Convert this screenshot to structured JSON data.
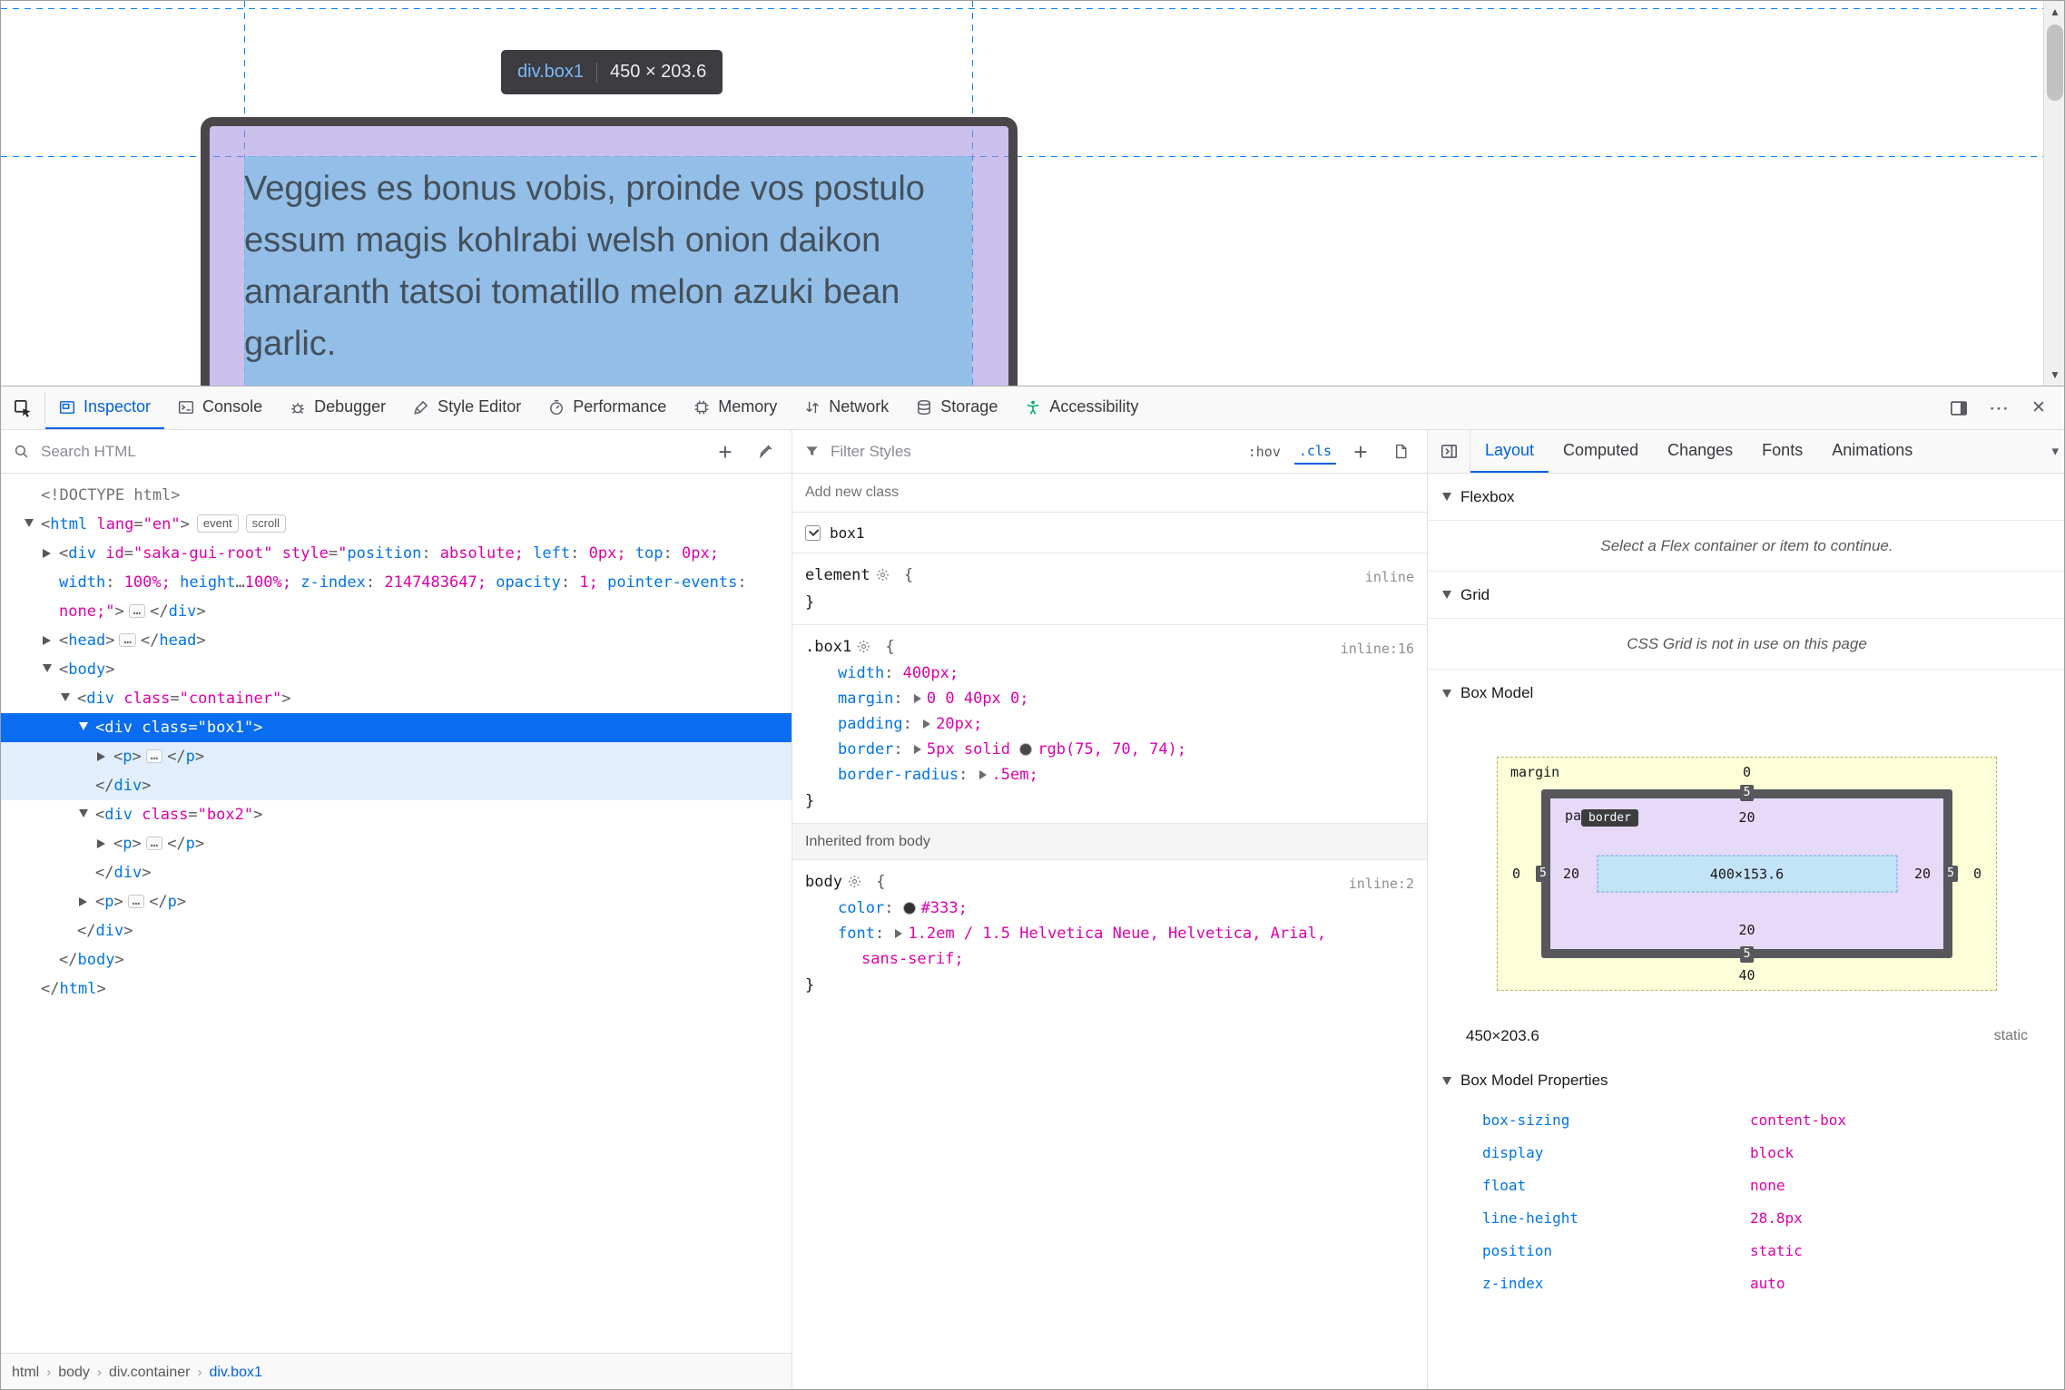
{
  "viewport": {
    "tooltip": {
      "selector": "div.box1",
      "dims": "450 × 203.6"
    },
    "content_lines": "Veggies es bonus vobis, proinde vos postulo\nessum magis kohlrabi welsh onion daikon\namaranth tatsoi tomatillo melon azuki bean\ngarlic."
  },
  "toolbar": {
    "tabs": [
      {
        "label": "Inspector",
        "icon": "inspector-icon",
        "active": true
      },
      {
        "label": "Console",
        "icon": "console-icon"
      },
      {
        "label": "Debugger",
        "icon": "debugger-icon"
      },
      {
        "label": "Style Editor",
        "icon": "style-editor-icon"
      },
      {
        "label": "Performance",
        "icon": "performance-icon"
      },
      {
        "label": "Memory",
        "icon": "memory-icon"
      },
      {
        "label": "Network",
        "icon": "network-icon"
      },
      {
        "label": "Storage",
        "icon": "storage-icon"
      },
      {
        "label": "Accessibility",
        "icon": "accessibility-icon"
      }
    ]
  },
  "markup": {
    "search_placeholder": "Search HTML",
    "breadcrumbs": [
      {
        "label": "html"
      },
      {
        "label": "body"
      },
      {
        "label": "div.container"
      },
      {
        "label": "div.box1",
        "selected": true
      }
    ],
    "tree": [
      {
        "i": 0,
        "p": [
          {
            "t": "<!DOCTYPE html>",
            "c": "d"
          }
        ]
      },
      {
        "i": 0,
        "tw": "o",
        "p": [
          {
            "t": "<",
            "c": "p"
          },
          {
            "t": "html",
            "c": "t"
          },
          {
            "t": " ",
            "c": "p"
          },
          {
            "t": "lang",
            "c": "a"
          },
          {
            "t": "=",
            "c": "p"
          },
          {
            "t": "\"en\"",
            "c": "a"
          },
          {
            "t": ">",
            "c": "p"
          },
          {
            "b": "event"
          },
          {
            "b": "scroll"
          }
        ]
      },
      {
        "i": 1,
        "tw": "c",
        "p": [
          {
            "t": "<",
            "c": "p"
          },
          {
            "t": "div",
            "c": "t"
          },
          {
            "t": " ",
            "c": "p"
          },
          {
            "t": "id",
            "c": "a"
          },
          {
            "t": "=",
            "c": "p"
          },
          {
            "t": "\"saka-gui-root\"",
            "c": "a"
          },
          {
            "t": " ",
            "c": "p"
          },
          {
            "t": "style",
            "c": "a"
          },
          {
            "t": "=",
            "c": "p"
          },
          {
            "t": "\"",
            "c": "a"
          },
          {
            "t": "position",
            "c": "n"
          },
          {
            "t": ": ",
            "c": "p"
          },
          {
            "t": "absolute;",
            "c": "v"
          },
          {
            "t": " ",
            "c": "p"
          },
          {
            "t": "left",
            "c": "n"
          },
          {
            "t": ": ",
            "c": "p"
          },
          {
            "t": "0px;",
            "c": "v"
          },
          {
            "t": " ",
            "c": "p"
          },
          {
            "t": "top",
            "c": "n"
          },
          {
            "t": ": ",
            "c": "p"
          },
          {
            "t": "0px;",
            "c": "v"
          },
          {
            "t": " ",
            "c": "p"
          },
          {
            "t": "width",
            "c": "n"
          },
          {
            "t": ": ",
            "c": "p"
          },
          {
            "t": "100%;",
            "c": "v"
          },
          {
            "t": " ",
            "c": "p"
          },
          {
            "t": "height",
            "c": "n"
          },
          {
            "t": "…",
            "c": "p"
          },
          {
            "t": "100%;",
            "c": "v"
          },
          {
            "t": " ",
            "c": "p"
          },
          {
            "t": "z-index",
            "c": "n"
          },
          {
            "t": ": ",
            "c": "p"
          },
          {
            "t": "2147483647;",
            "c": "v"
          },
          {
            "t": " ",
            "c": "p"
          },
          {
            "t": "opacity",
            "c": "n"
          },
          {
            "t": ": ",
            "c": "p"
          },
          {
            "t": "1;",
            "c": "v"
          },
          {
            "t": " ",
            "c": "p"
          },
          {
            "t": "pointer-events",
            "c": "n"
          },
          {
            "t": ": ",
            "c": "p"
          },
          {
            "t": "none;",
            "c": "v"
          },
          {
            "t": "\"",
            "c": "a"
          },
          {
            "t": ">",
            "c": "p"
          },
          {
            "e": true
          },
          {
            "t": "</",
            "c": "p"
          },
          {
            "t": "div",
            "c": "t"
          },
          {
            "t": ">",
            "c": "p"
          }
        ]
      },
      {
        "i": 1,
        "tw": "c",
        "p": [
          {
            "t": "<",
            "c": "p"
          },
          {
            "t": "head",
            "c": "t"
          },
          {
            "t": ">",
            "c": "p"
          },
          {
            "e": true
          },
          {
            "t": "</",
            "c": "p"
          },
          {
            "t": "head",
            "c": "t"
          },
          {
            "t": ">",
            "c": "p"
          }
        ]
      },
      {
        "i": 1,
        "tw": "o",
        "p": [
          {
            "t": "<",
            "c": "p"
          },
          {
            "t": "body",
            "c": "t"
          },
          {
            "t": ">",
            "c": "p"
          }
        ]
      },
      {
        "i": 2,
        "tw": "o",
        "p": [
          {
            "t": "<",
            "c": "p"
          },
          {
            "t": "div",
            "c": "t"
          },
          {
            "t": " ",
            "c": "p"
          },
          {
            "t": "class",
            "c": "a"
          },
          {
            "t": "=",
            "c": "p"
          },
          {
            "t": "\"container\"",
            "c": "a"
          },
          {
            "t": ">",
            "c": "p"
          }
        ]
      },
      {
        "i": 3,
        "tw": "o",
        "sel": true,
        "p": [
          {
            "t": "<",
            "c": "p"
          },
          {
            "t": "div",
            "c": "t"
          },
          {
            "t": " ",
            "c": "p"
          },
          {
            "t": "class",
            "c": "a"
          },
          {
            "t": "=",
            "c": "p"
          },
          {
            "t": "\"box1\"",
            "c": "a"
          },
          {
            "t": ">",
            "c": "p"
          }
        ]
      },
      {
        "i": 4,
        "tw": "c",
        "hl": true,
        "p": [
          {
            "t": "<",
            "c": "p"
          },
          {
            "t": "p",
            "c": "t"
          },
          {
            "t": ">",
            "c": "p"
          },
          {
            "e": true
          },
          {
            "t": "</",
            "c": "p"
          },
          {
            "t": "p",
            "c": "t"
          },
          {
            "t": ">",
            "c": "p"
          }
        ]
      },
      {
        "i": 3,
        "hl": true,
        "p": [
          {
            "t": "</",
            "c": "p"
          },
          {
            "t": "div",
            "c": "t"
          },
          {
            "t": ">",
            "c": "p"
          }
        ]
      },
      {
        "i": 3,
        "tw": "o",
        "p": [
          {
            "t": "<",
            "c": "p"
          },
          {
            "t": "div",
            "c": "t"
          },
          {
            "t": " ",
            "c": "p"
          },
          {
            "t": "class",
            "c": "a"
          },
          {
            "t": "=",
            "c": "p"
          },
          {
            "t": "\"box2\"",
            "c": "a"
          },
          {
            "t": ">",
            "c": "p"
          }
        ]
      },
      {
        "i": 4,
        "tw": "c",
        "p": [
          {
            "t": "<",
            "c": "p"
          },
          {
            "t": "p",
            "c": "t"
          },
          {
            "t": ">",
            "c": "p"
          },
          {
            "e": true
          },
          {
            "t": "</",
            "c": "p"
          },
          {
            "t": "p",
            "c": "t"
          },
          {
            "t": ">",
            "c": "p"
          }
        ]
      },
      {
        "i": 3,
        "p": [
          {
            "t": "</",
            "c": "p"
          },
          {
            "t": "div",
            "c": "t"
          },
          {
            "t": ">",
            "c": "p"
          }
        ]
      },
      {
        "i": 3,
        "tw": "c",
        "p": [
          {
            "t": "<",
            "c": "p"
          },
          {
            "t": "p",
            "c": "t"
          },
          {
            "t": ">",
            "c": "p"
          },
          {
            "e": true
          },
          {
            "t": "</",
            "c": "p"
          },
          {
            "t": "p",
            "c": "t"
          },
          {
            "t": ">",
            "c": "p"
          }
        ]
      },
      {
        "i": 2,
        "p": [
          {
            "t": "</",
            "c": "p"
          },
          {
            "t": "div",
            "c": "t"
          },
          {
            "t": ">",
            "c": "p"
          }
        ]
      },
      {
        "i": 1,
        "p": [
          {
            "t": "</",
            "c": "p"
          },
          {
            "t": "body",
            "c": "t"
          },
          {
            "t": ">",
            "c": "p"
          }
        ]
      },
      {
        "i": 0,
        "p": [
          {
            "t": "</",
            "c": "p"
          },
          {
            "t": "html",
            "c": "t"
          },
          {
            "t": ">",
            "c": "p"
          }
        ]
      }
    ]
  },
  "rules": {
    "filter_placeholder": "Filter Styles",
    "pseudo_toggle": ":hov",
    "class_toggle": ".cls",
    "add_class_placeholder": "Add new class",
    "class_checkbox": {
      "label": "box1",
      "checked": true
    },
    "blocks": [
      {
        "selector": "element",
        "location": "inline",
        "decls": []
      },
      {
        "selector": ".box1",
        "location": "inline:16",
        "decls": [
          {
            "name": "width",
            "value": [
              {
                "t": "400px;"
              }
            ]
          },
          {
            "name": "margin",
            "arrow": true,
            "value": [
              {
                "t": "0 0 40px 0;"
              }
            ]
          },
          {
            "name": "padding",
            "arrow": true,
            "value": [
              {
                "t": "20px;"
              }
            ]
          },
          {
            "name": "border",
            "arrow": true,
            "value": [
              {
                "t": "5px solid "
              },
              {
                "swatch": "#4b464a"
              },
              {
                "t": "rgb(75, 70, 74);"
              }
            ]
          },
          {
            "name": "border-radius",
            "arrow": true,
            "value": [
              {
                "t": ".5em;"
              }
            ]
          }
        ]
      }
    ],
    "inherited_header": "Inherited from body",
    "inherited_blocks": [
      {
        "selector": "body",
        "location": "inline:2",
        "decls": [
          {
            "name": "color",
            "value": [
              {
                "swatch": "#333333"
              },
              {
                "t": "#333;"
              }
            ]
          },
          {
            "name": "font",
            "arrow": true,
            "value": [
              {
                "t": "1.2em / 1.5 Helvetica Neue, Helvetica, Arial,"
              },
              {
                "br": true
              },
              {
                "t": "sans-serif;"
              }
            ]
          }
        ]
      }
    ]
  },
  "layout": {
    "tabs": [
      {
        "label": "Layout",
        "active": true
      },
      {
        "label": "Computed"
      },
      {
        "label": "Changes"
      },
      {
        "label": "Fonts"
      },
      {
        "label": "Animations"
      }
    ],
    "flexbox": {
      "title": "Flexbox",
      "message": "Select a Flex container or item to continue."
    },
    "grid": {
      "title": "Grid",
      "message": "CSS Grid is not in use on this page"
    },
    "box_model": {
      "title": "Box Model",
      "margin_label": "margin",
      "border_label": "border",
      "padding_label": "padding",
      "margin": {
        "top": "0",
        "right": "0",
        "bottom": "40",
        "left": "0"
      },
      "border": {
        "top": "5",
        "right": "5",
        "bottom": "5",
        "left": "5"
      },
      "padding": {
        "top": "20",
        "right": "20",
        "bottom": "20",
        "left": "20"
      },
      "content": "400×153.6",
      "dimensions": "450×203.6",
      "position": "static"
    },
    "properties_title": "Box Model Properties",
    "properties": [
      {
        "name": "box-sizing",
        "value": "content-box"
      },
      {
        "name": "display",
        "value": "block"
      },
      {
        "name": "float",
        "value": "none"
      },
      {
        "name": "line-height",
        "value": "28.8px"
      },
      {
        "name": "position",
        "value": "static"
      },
      {
        "name": "z-index",
        "value": "auto"
      }
    ]
  }
}
